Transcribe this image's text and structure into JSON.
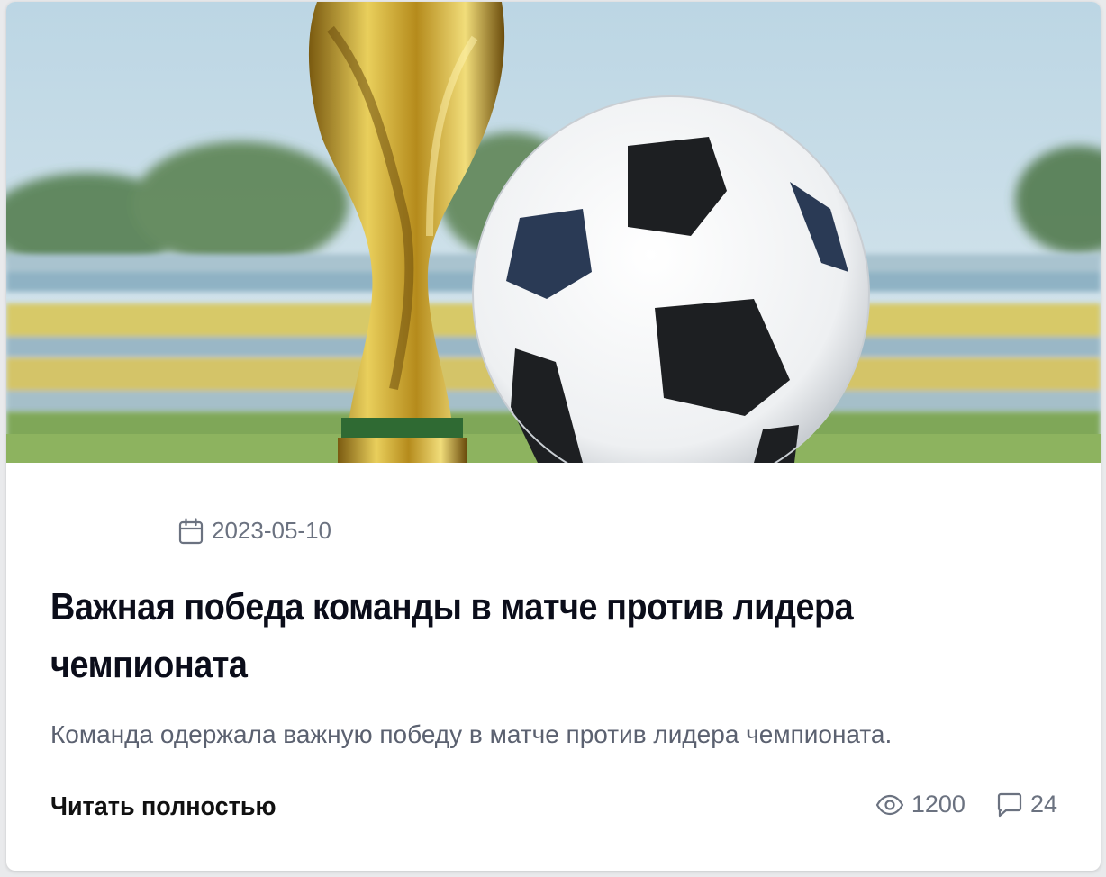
{
  "article": {
    "image": {
      "subject": "football-and-trophy-photo",
      "colors": {
        "sky": "#c9dde7",
        "grass": "#7da654",
        "stands_yellow": "#d9c85a",
        "trophy_gold": "#c9a227",
        "ball_black": "#1d1f22"
      }
    },
    "date": "2023-05-10",
    "date_icon": "calendar-icon",
    "title": "Важная победа команды в матче против лидера чемпионата",
    "excerpt": "Команда одержала важную победу в матче против лидера чемпионата.",
    "read_more_label": "Читать полностью",
    "stats": {
      "views_icon": "eye-icon",
      "views": "1200",
      "comments_icon": "comment-icon",
      "comments": "24"
    }
  }
}
